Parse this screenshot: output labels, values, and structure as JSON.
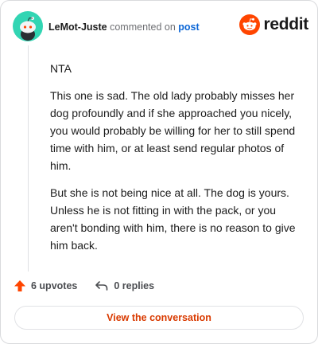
{
  "header": {
    "username": "LeMot-Juste",
    "action_text": "commented on",
    "post_link": "post",
    "logo_text": "reddit"
  },
  "comment": {
    "paragraphs": [
      "NTA",
      "This one is sad. The old lady probably misses her dog profoundly and if she approached you nicely, you would probably be willing for her to still spend time with him, or at least send regular photos of him.",
      "But she is not being nice at all. The dog is yours. Unless he is not fitting in with the pack, or you aren't bonding with him, there is no reason to give him back."
    ]
  },
  "actions": {
    "upvotes_label": "6 upvotes",
    "replies_label": "0 replies"
  },
  "cta": {
    "label": "View the conversation"
  },
  "colors": {
    "accent": "#d93a00",
    "link": "#0b66d6",
    "avatar_bg": "#32d5b3",
    "reddit_orange": "#ff4500"
  },
  "icons": {
    "avatar": "snoo-avatar-icon",
    "logo": "reddit-logo-icon",
    "upvote": "upvote-arrow-icon",
    "reply": "reply-arrow-icon"
  }
}
